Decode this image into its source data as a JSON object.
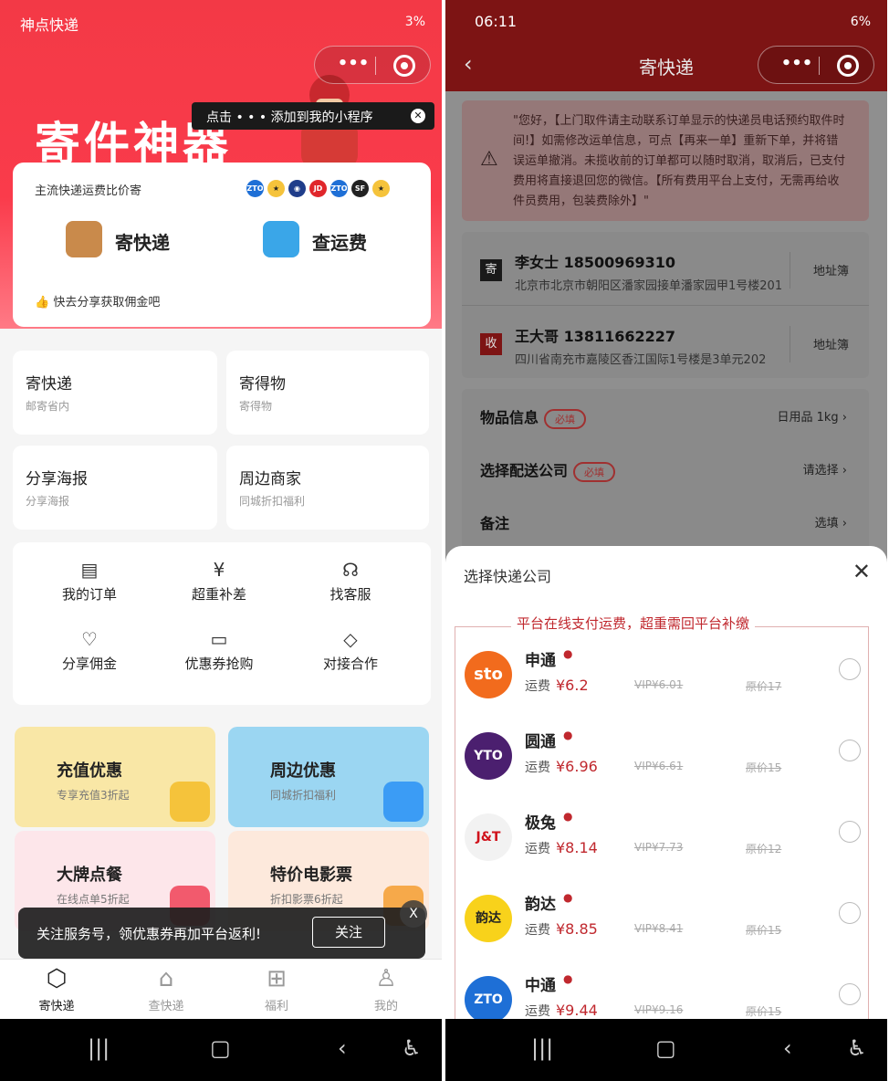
{
  "left": {
    "status": {
      "time": "神点快递",
      "battery": "3%"
    },
    "hero_title": "寄件神器",
    "tip": "点击 • • • 添加到我的小程序",
    "compare_title": "主流快递运费比价寄",
    "carrier_logos": [
      "ZTO",
      "★",
      "◉",
      "JD",
      "ZTO",
      "SF",
      "★"
    ],
    "send_label": "寄快递",
    "query_label": "查运费",
    "share_text": "快去分享获取佣金吧",
    "tiles": [
      {
        "title": "寄快递",
        "sub": "邮寄省内"
      },
      {
        "title": "寄得物",
        "sub": "寄得物"
      },
      {
        "title": "分享海报",
        "sub": "分享海报"
      },
      {
        "title": "周边商家",
        "sub": "同城折扣福利"
      }
    ],
    "grid": [
      {
        "icon": "order-icon",
        "glyph": "▤",
        "label": "我的订单"
      },
      {
        "icon": "overweight-icon",
        "glyph": "¥",
        "label": "超重补差"
      },
      {
        "icon": "service-icon",
        "glyph": "☊",
        "label": "找客服"
      },
      {
        "icon": "commission-icon",
        "glyph": "♡",
        "label": "分享佣金"
      },
      {
        "icon": "coupon-icon",
        "glyph": "▭",
        "label": "优惠券抢购"
      },
      {
        "icon": "handshake-icon",
        "glyph": "◇",
        "label": "对接合作"
      }
    ],
    "promos": [
      {
        "title": "充值优惠",
        "sub": "专享充值3折起",
        "bg": "#f9e7a6",
        "badge": "#f5c33b"
      },
      {
        "title": "周边优惠",
        "sub": "同城折扣福利",
        "bg": "#9bd6f2",
        "badge": "#3b9cf5"
      },
      {
        "title": "大牌点餐",
        "sub": "在线点单5折起",
        "bg": "#fde6ea",
        "badge": "#f25a6d"
      },
      {
        "title": "特价电影票",
        "sub": "折扣影票6折起",
        "bg": "#fde9dc",
        "badge": "#f6a94a"
      }
    ],
    "toast": {
      "message": "关注服务号，领优惠券再加平台返利!",
      "button": "关注",
      "close": "X"
    },
    "tabs": [
      {
        "icon": "package-icon",
        "glyph": "⬡",
        "label": "寄快递",
        "active": true
      },
      {
        "icon": "query-icon",
        "glyph": "⌂",
        "label": "查快递",
        "active": false
      },
      {
        "icon": "gift-icon",
        "glyph": "⊞",
        "label": "福利",
        "active": false
      },
      {
        "icon": "user-icon",
        "glyph": "♙",
        "label": "我的",
        "active": false
      }
    ]
  },
  "right": {
    "status": {
      "time": "06:11",
      "battery": "6%"
    },
    "title": "寄快递",
    "notice": "\"您好，【上门取件请主动联系订单显示的快递员电话预约取件时间!】如需修改运单信息，可点【再来一单】重新下单，并将错误运单撤消。未揽收前的订单都可以随时取消，取消后，已支付费用将直接退回您的微信。【所有费用平台上支付，无需再给收件员费用，包装费除外】\"",
    "sender": {
      "tag": "寄",
      "name": "李女士 18500969310",
      "address": "北京市北京市朝阳区潘家园接单潘家园甲1号楼201",
      "book": "地址簿"
    },
    "receiver": {
      "tag": "收",
      "name": "王大哥 13811662227",
      "address": "四川省南充市嘉陵区香江国际1号楼是3单元202",
      "book": "地址簿"
    },
    "rows": [
      {
        "key": "物品信息",
        "required": "必填",
        "value": "日用品 1kg ›"
      },
      {
        "key": "选择配送公司",
        "required": "必填",
        "value": "请选择 ›"
      },
      {
        "key": "备注",
        "required": "",
        "value": "选填 ›"
      }
    ],
    "sheet_title": "选择快递公司",
    "banner": "平台在线支付运费，超重需回平台补缴",
    "couriers": [
      {
        "name": "申通",
        "price_label": "运费",
        "price": "¥6.2",
        "vip": "VIP¥6.01",
        "orig": "原价17",
        "logo_text": "sto",
        "logo_bg": "#f26b1d",
        "logo_fg": "#ffffff"
      },
      {
        "name": "圆通",
        "price_label": "运费",
        "price": "¥6.96",
        "vip": "VIP¥6.61",
        "orig": "原价15",
        "logo_text": "YTO",
        "logo_bg": "#4b1f6f",
        "logo_fg": "#ffffff"
      },
      {
        "name": "极兔",
        "price_label": "运费",
        "price": "¥8.14",
        "vip": "VIP¥7.73",
        "orig": "原价12",
        "logo_text": "J&T",
        "logo_bg": "#f2f2f2",
        "logo_fg": "#d0121b"
      },
      {
        "name": "韵达",
        "price_label": "运费",
        "price": "¥8.85",
        "vip": "VIP¥8.41",
        "orig": "原价15",
        "logo_text": "韵达",
        "logo_bg": "#f8d21b",
        "logo_fg": "#222222"
      },
      {
        "name": "中通",
        "price_label": "运费",
        "price": "¥9.44",
        "vip": "VIP¥9.16",
        "orig": "原价15",
        "logo_text": "ZTO",
        "logo_bg": "#1e6fd6",
        "logo_fg": "#ffffff"
      }
    ]
  },
  "colors": {
    "brand_red": "#f33946",
    "price_red": "#c0282e"
  }
}
